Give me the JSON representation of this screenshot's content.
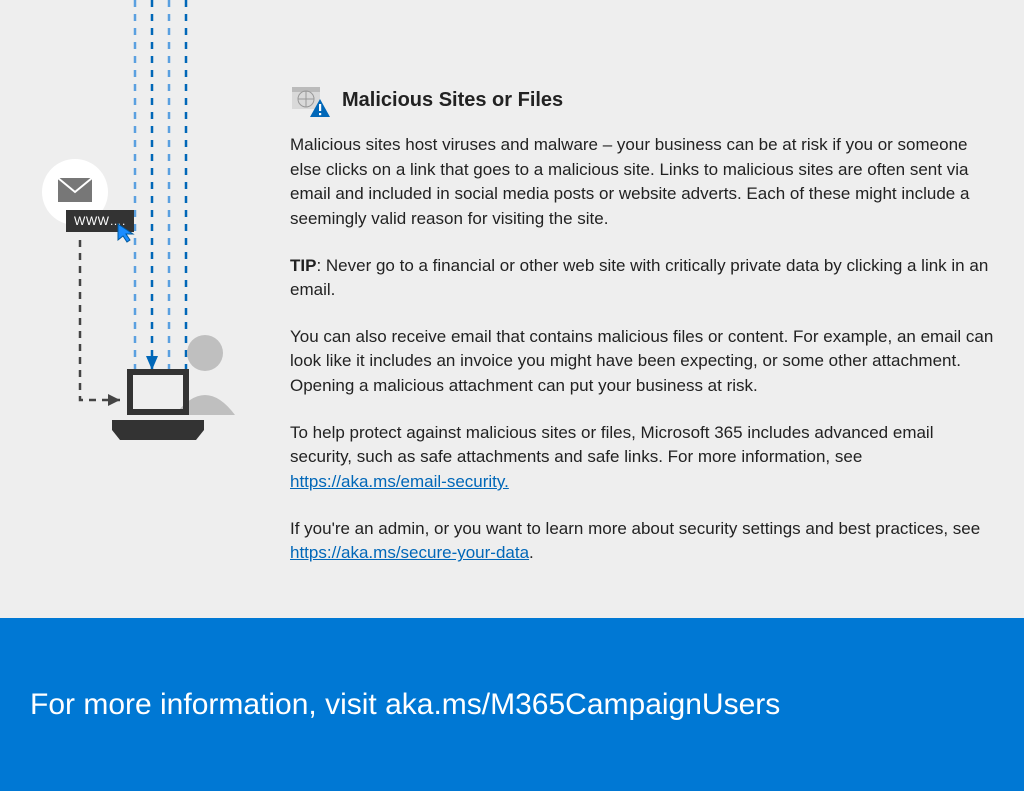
{
  "heading": "Malicious Sites or Files",
  "paragraphs": {
    "p1": "Malicious sites host viruses and malware – your business can be at risk if you or someone else clicks on a link that goes to a malicious site. Links to malicious sites are often sent via email and included in social media posts or website adverts. Each of these might include a seemingly valid reason for visiting the site.",
    "tipLabel": "TIP",
    "tipText": ": Never go to a financial or other web site with critically private data by clicking a link in an email.",
    "p3": "You can also receive email that contains malicious files or content. For example, an email can look like it includes an invoice you might have been expecting, or some other attachment. Opening a malicious attachment can put your business at risk.",
    "p4a": "To help protect against malicious sites or files, Microsoft 365 includes advanced email security, such as safe attachments and safe links. For more information, see ",
    "link1": "https://aka.ms/email-security.",
    "p5a": "If you're an admin, or you want to learn more about security settings and best practices, see ",
    "link2": "https://aka.ms/secure-your-data",
    "p5b": "."
  },
  "illustration": {
    "wwwLabel": "WWW…."
  },
  "footer": "For more information, visit aka.ms/M365CampaignUsers"
}
